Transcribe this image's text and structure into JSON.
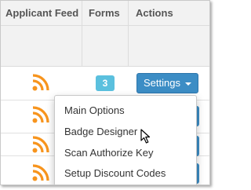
{
  "table": {
    "columns": {
      "applicant_feed": "Applicant Feed",
      "forms": "Forms",
      "actions": "Actions"
    },
    "first_row": {
      "forms_count": "3",
      "actions_button": "Settings"
    }
  },
  "dropdown": {
    "items": [
      {
        "label": "Main Options"
      },
      {
        "label": "Badge Designer"
      },
      {
        "label": "Scan Authorize Key"
      },
      {
        "label": "Setup Discount Codes"
      }
    ]
  },
  "colors": {
    "rss": "#f7941d",
    "badge": "#5bc0de",
    "button": "#3c8dc5"
  }
}
